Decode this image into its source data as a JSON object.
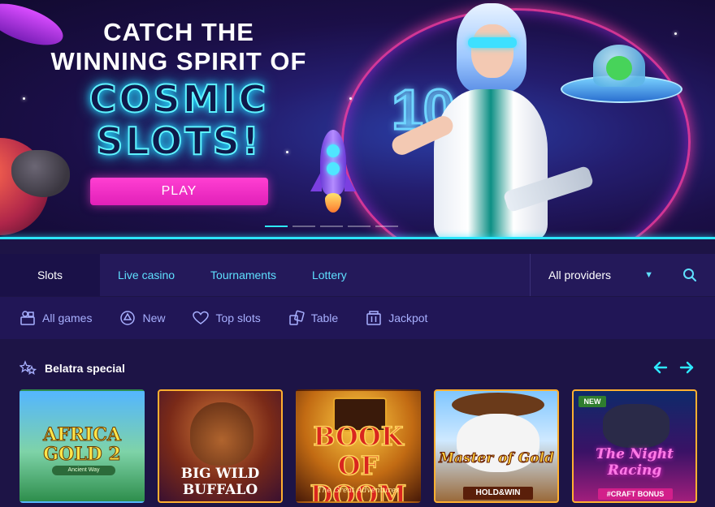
{
  "hero": {
    "title_line1": "CATCH THE",
    "title_line2": "WINNING SPIRIT OF",
    "neon_line1": "COSMIC",
    "neon_line2": "SLOTS!",
    "play_label": "PLAY",
    "badge_number": "10",
    "slides_count": 5,
    "active_slide": 0
  },
  "tabs": {
    "items": [
      {
        "label": "Slots",
        "active": true
      },
      {
        "label": "Live casino",
        "active": false
      },
      {
        "label": "Tournaments",
        "active": false
      },
      {
        "label": "Lottery",
        "active": false
      }
    ],
    "provider_select": "All providers"
  },
  "filters": [
    {
      "label": "All games",
      "icon": "all-games-icon"
    },
    {
      "label": "New",
      "icon": "new-icon"
    },
    {
      "label": "Top slots",
      "icon": "heart-icon"
    },
    {
      "label": "Table",
      "icon": "cards-icon"
    },
    {
      "label": "Jackpot",
      "icon": "jackpot-icon"
    }
  ],
  "special": {
    "title": "Belatra special",
    "icon": "stars-icon",
    "games": [
      {
        "name": "AFRICA GOLD 2",
        "subtitle": "Ancient Way"
      },
      {
        "name": "BIG WILD BUFFALO"
      },
      {
        "name": "BOOK OF DOOM",
        "tagline": "The Great Adventures"
      },
      {
        "name": "Master of Gold",
        "badge": "HOLD&WIN"
      },
      {
        "name": "The Night Racing",
        "new_label": "NEW",
        "badge": "#CRAFT BONUS"
      }
    ]
  },
  "colors": {
    "accent_cyan": "#2ee8ff",
    "accent_pink": "#e120b8",
    "tab_text": "#5fe0ff",
    "filter_text": "#a8b0ff",
    "bg": "#1d1446"
  }
}
